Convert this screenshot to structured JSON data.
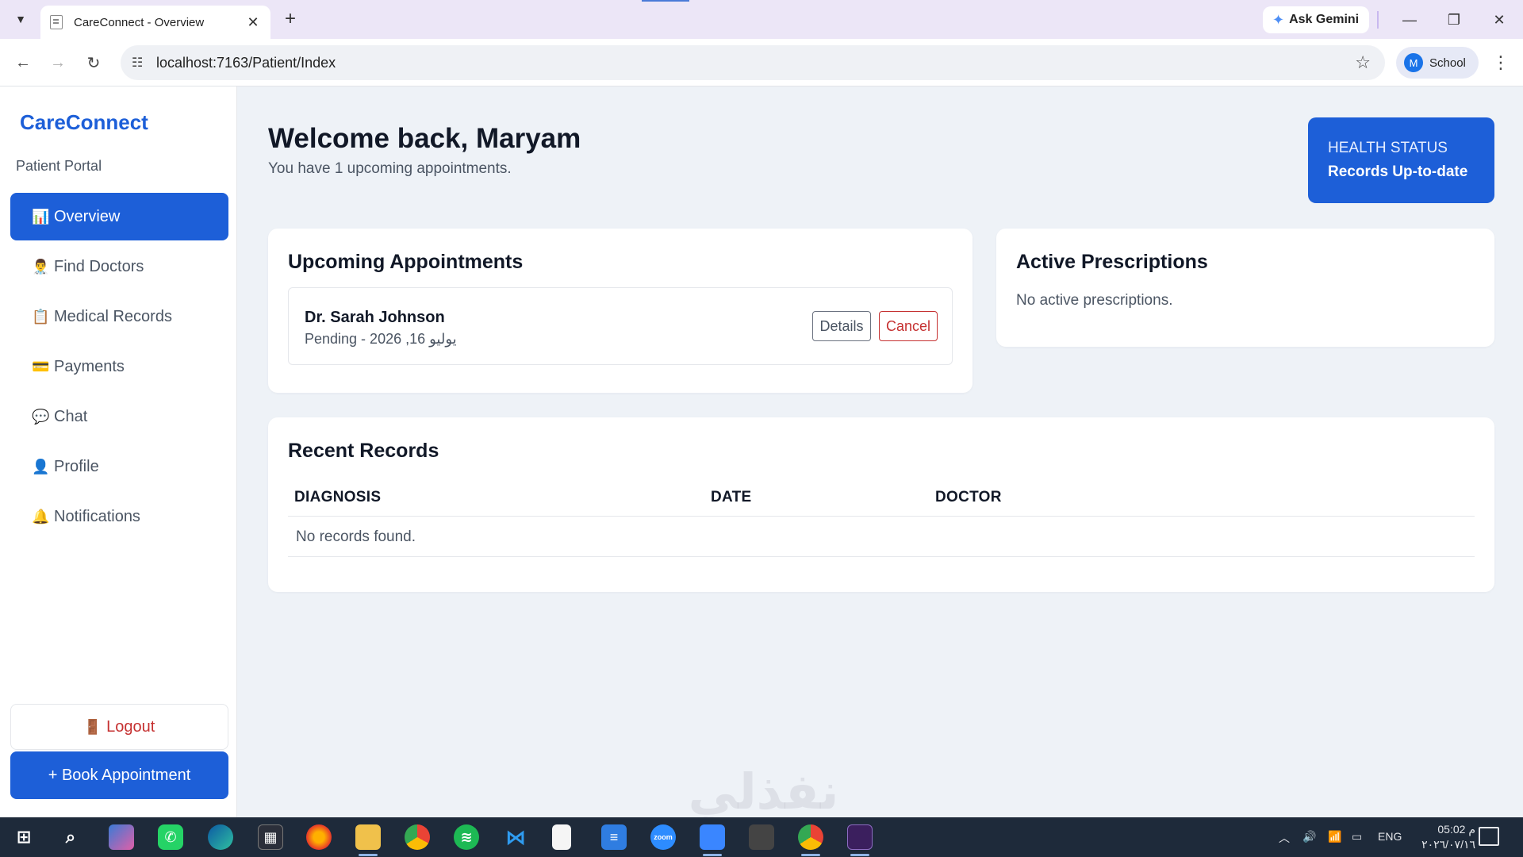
{
  "browser": {
    "tab_title": "CareConnect - Overview",
    "tab_close": "✕",
    "new_tab": "+",
    "ask_gemini": "Ask Gemini",
    "url": "localhost:7163/Patient/Index",
    "profile_initial": "M",
    "profile_name": "School"
  },
  "sidebar": {
    "brand": "CareConnect",
    "portal_label": "Patient Portal",
    "items": [
      {
        "icon": "📊",
        "label": "Overview",
        "active": true
      },
      {
        "icon": "👨‍⚕️",
        "label": "Find Doctors"
      },
      {
        "icon": "📋",
        "label": "Medical Records"
      },
      {
        "icon": "💳",
        "label": "Payments"
      },
      {
        "icon": "💬",
        "label": "Chat"
      },
      {
        "icon": "👤",
        "label": "Profile"
      },
      {
        "icon": "🔔",
        "label": "Notifications"
      }
    ],
    "logout_icon": "🚪",
    "logout_label": "Logout",
    "book_label": "+ Book Appointment"
  },
  "main": {
    "welcome": "Welcome back, Maryam",
    "subtitle": "You have 1 upcoming appointments.",
    "health_status": {
      "label": "HEALTH STATUS",
      "value": "Records Up-to-date"
    },
    "appointments": {
      "title": "Upcoming Appointments",
      "items": [
        {
          "doctor": "Dr. Sarah Johnson",
          "meta": "Pending - 2026 ,16 يوليو",
          "details_label": "Details",
          "cancel_label": "Cancel"
        }
      ]
    },
    "prescriptions": {
      "title": "Active Prescriptions",
      "empty": "No active prescriptions."
    },
    "records": {
      "title": "Recent Records",
      "columns": [
        "DIAGNOSIS",
        "DATE",
        "DOCTOR"
      ],
      "empty": "No records found."
    }
  },
  "watermark": "نفذلي",
  "taskbar": {
    "lang": "ENG",
    "time": "05:02 م",
    "date": "٢٠٢٦/٠٧/١٦"
  }
}
